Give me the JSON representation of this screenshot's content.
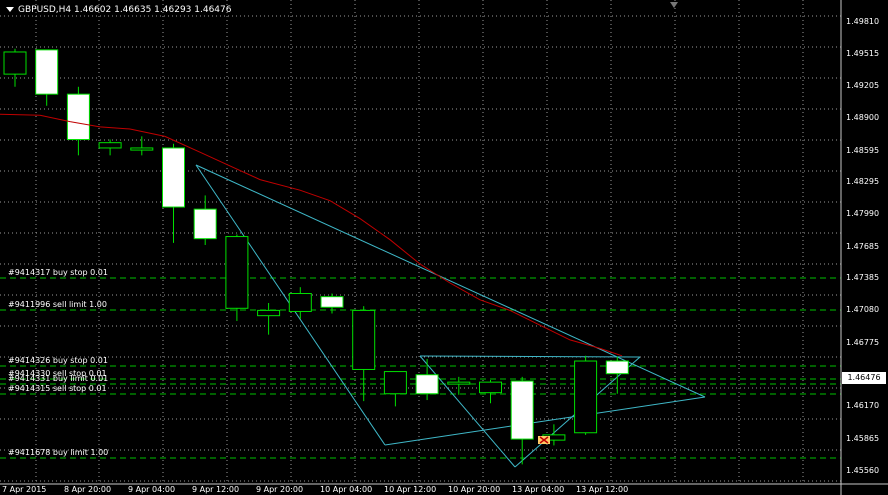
{
  "header": {
    "title": "GBPUSD,H4  1.46602 1.46635 1.46293 1.46476"
  },
  "colors": {
    "background": "#000000",
    "grid": "#c8c8c8",
    "candle_bull": "#ffffff",
    "candle_bear": "#000000",
    "candle_outline": "#00e000",
    "moving_average": "#c00000",
    "triangle_lines": "#3fb8c8",
    "order_lines": "#00c000"
  },
  "y_axis": {
    "labels": [
      "1.49810",
      "1.49515",
      "1.49205",
      "1.48900",
      "1.48595",
      "1.48295",
      "1.47990",
      "1.47685",
      "1.47385",
      "1.47080",
      "1.46775",
      "1.46170",
      "1.45865",
      "1.45560"
    ],
    "current_price": "1.46476"
  },
  "x_axis": {
    "labels": [
      "7 Apr 2015",
      "8 Apr 20:00",
      "9 Apr 04:00",
      "9 Apr 12:00",
      "9 Apr 20:00",
      "10 Apr 04:00",
      "10 Apr 12:00",
      "10 Apr 20:00",
      "13 Apr 04:00",
      "13 Apr 12:00"
    ]
  },
  "orders": [
    {
      "label": "#9414317 buy stop 0.01",
      "price": 1.47385,
      "style": "dashed"
    },
    {
      "label": "#9411996 sell limit 1.00",
      "price": 1.4708,
      "style": "dashed"
    },
    {
      "label": "#9414326 buy stop 0.01",
      "price": 1.4655,
      "style": "dashed"
    },
    {
      "label": "#9414330 sell stop 0.01",
      "price": 1.4643,
      "style": "dashed"
    },
    {
      "label": "#9414331 buy limit 0.01",
      "price": 1.4638,
      "style": "dashed"
    },
    {
      "label": "#9414315 sell stop 0.01",
      "price": 1.4629,
      "style": "dashed"
    },
    {
      "label": "#9411678 buy limit 1.00",
      "price": 1.4568,
      "style": "dashed"
    }
  ],
  "chart_data": {
    "type": "candlestick",
    "symbol": "GBPUSD",
    "timeframe": "H4",
    "ylim": [
      1.4551,
      1.4989
    ],
    "candles": [
      {
        "o": 1.4932,
        "h": 1.4956,
        "l": 1.492,
        "c": 1.4953
      },
      {
        "o": 1.4955,
        "h": 1.4955,
        "l": 1.4902,
        "c": 1.4913
      },
      {
        "o": 1.4913,
        "h": 1.492,
        "l": 1.4855,
        "c": 1.487
      },
      {
        "o": 1.4862,
        "h": 1.487,
        "l": 1.4855,
        "c": 1.4867
      },
      {
        "o": 1.486,
        "h": 1.4873,
        "l": 1.4855,
        "c": 1.4862
      },
      {
        "o": 1.4862,
        "h": 1.4866,
        "l": 1.4772,
        "c": 1.4806
      },
      {
        "o": 1.4804,
        "h": 1.4817,
        "l": 1.477,
        "c": 1.4776
      },
      {
        "o": 1.471,
        "h": 1.478,
        "l": 1.4698,
        "c": 1.4778
      },
      {
        "o": 1.4703,
        "h": 1.4715,
        "l": 1.4685,
        "c": 1.4708
      },
      {
        "o": 1.4707,
        "h": 1.473,
        "l": 1.47,
        "c": 1.4724
      },
      {
        "o": 1.4721,
        "h": 1.4724,
        "l": 1.4705,
        "c": 1.4711
      },
      {
        "o": 1.4652,
        "h": 1.4712,
        "l": 1.4622,
        "c": 1.4708
      },
      {
        "o": 1.4629,
        "h": 1.465,
        "l": 1.4617,
        "c": 1.465
      },
      {
        "o": 1.4647,
        "h": 1.4662,
        "l": 1.4623,
        "c": 1.4629
      },
      {
        "o": 1.464,
        "h": 1.4645,
        "l": 1.4628,
        "c": 1.464
      },
      {
        "o": 1.463,
        "h": 1.4642,
        "l": 1.462,
        "c": 1.464
      },
      {
        "o": 1.4641,
        "h": 1.4645,
        "l": 1.4562,
        "c": 1.4586
      },
      {
        "o": 1.4585,
        "h": 1.46,
        "l": 1.458,
        "c": 1.459
      },
      {
        "o": 1.4592,
        "h": 1.4665,
        "l": 1.459,
        "c": 1.466
      },
      {
        "o": 1.466,
        "h": 1.4664,
        "l": 1.4629,
        "c": 1.4648
      }
    ],
    "moving_average": [
      [
        0,
        1.4894
      ],
      [
        1,
        1.4893
      ],
      [
        2,
        1.4888
      ],
      [
        3,
        1.4883
      ],
      [
        4,
        1.4878
      ],
      [
        5,
        1.4868
      ],
      [
        6,
        1.4852
      ],
      [
        7,
        1.4834
      ],
      [
        8,
        1.4826
      ],
      [
        9,
        1.4813
      ],
      [
        10,
        1.4796
      ],
      [
        11,
        1.4771
      ],
      [
        12,
        1.4752
      ],
      [
        13,
        1.4735
      ],
      [
        14,
        1.4719
      ],
      [
        15,
        1.4706
      ],
      [
        16,
        1.4693
      ],
      [
        17,
        1.468
      ],
      [
        18,
        1.4664
      ]
    ]
  }
}
